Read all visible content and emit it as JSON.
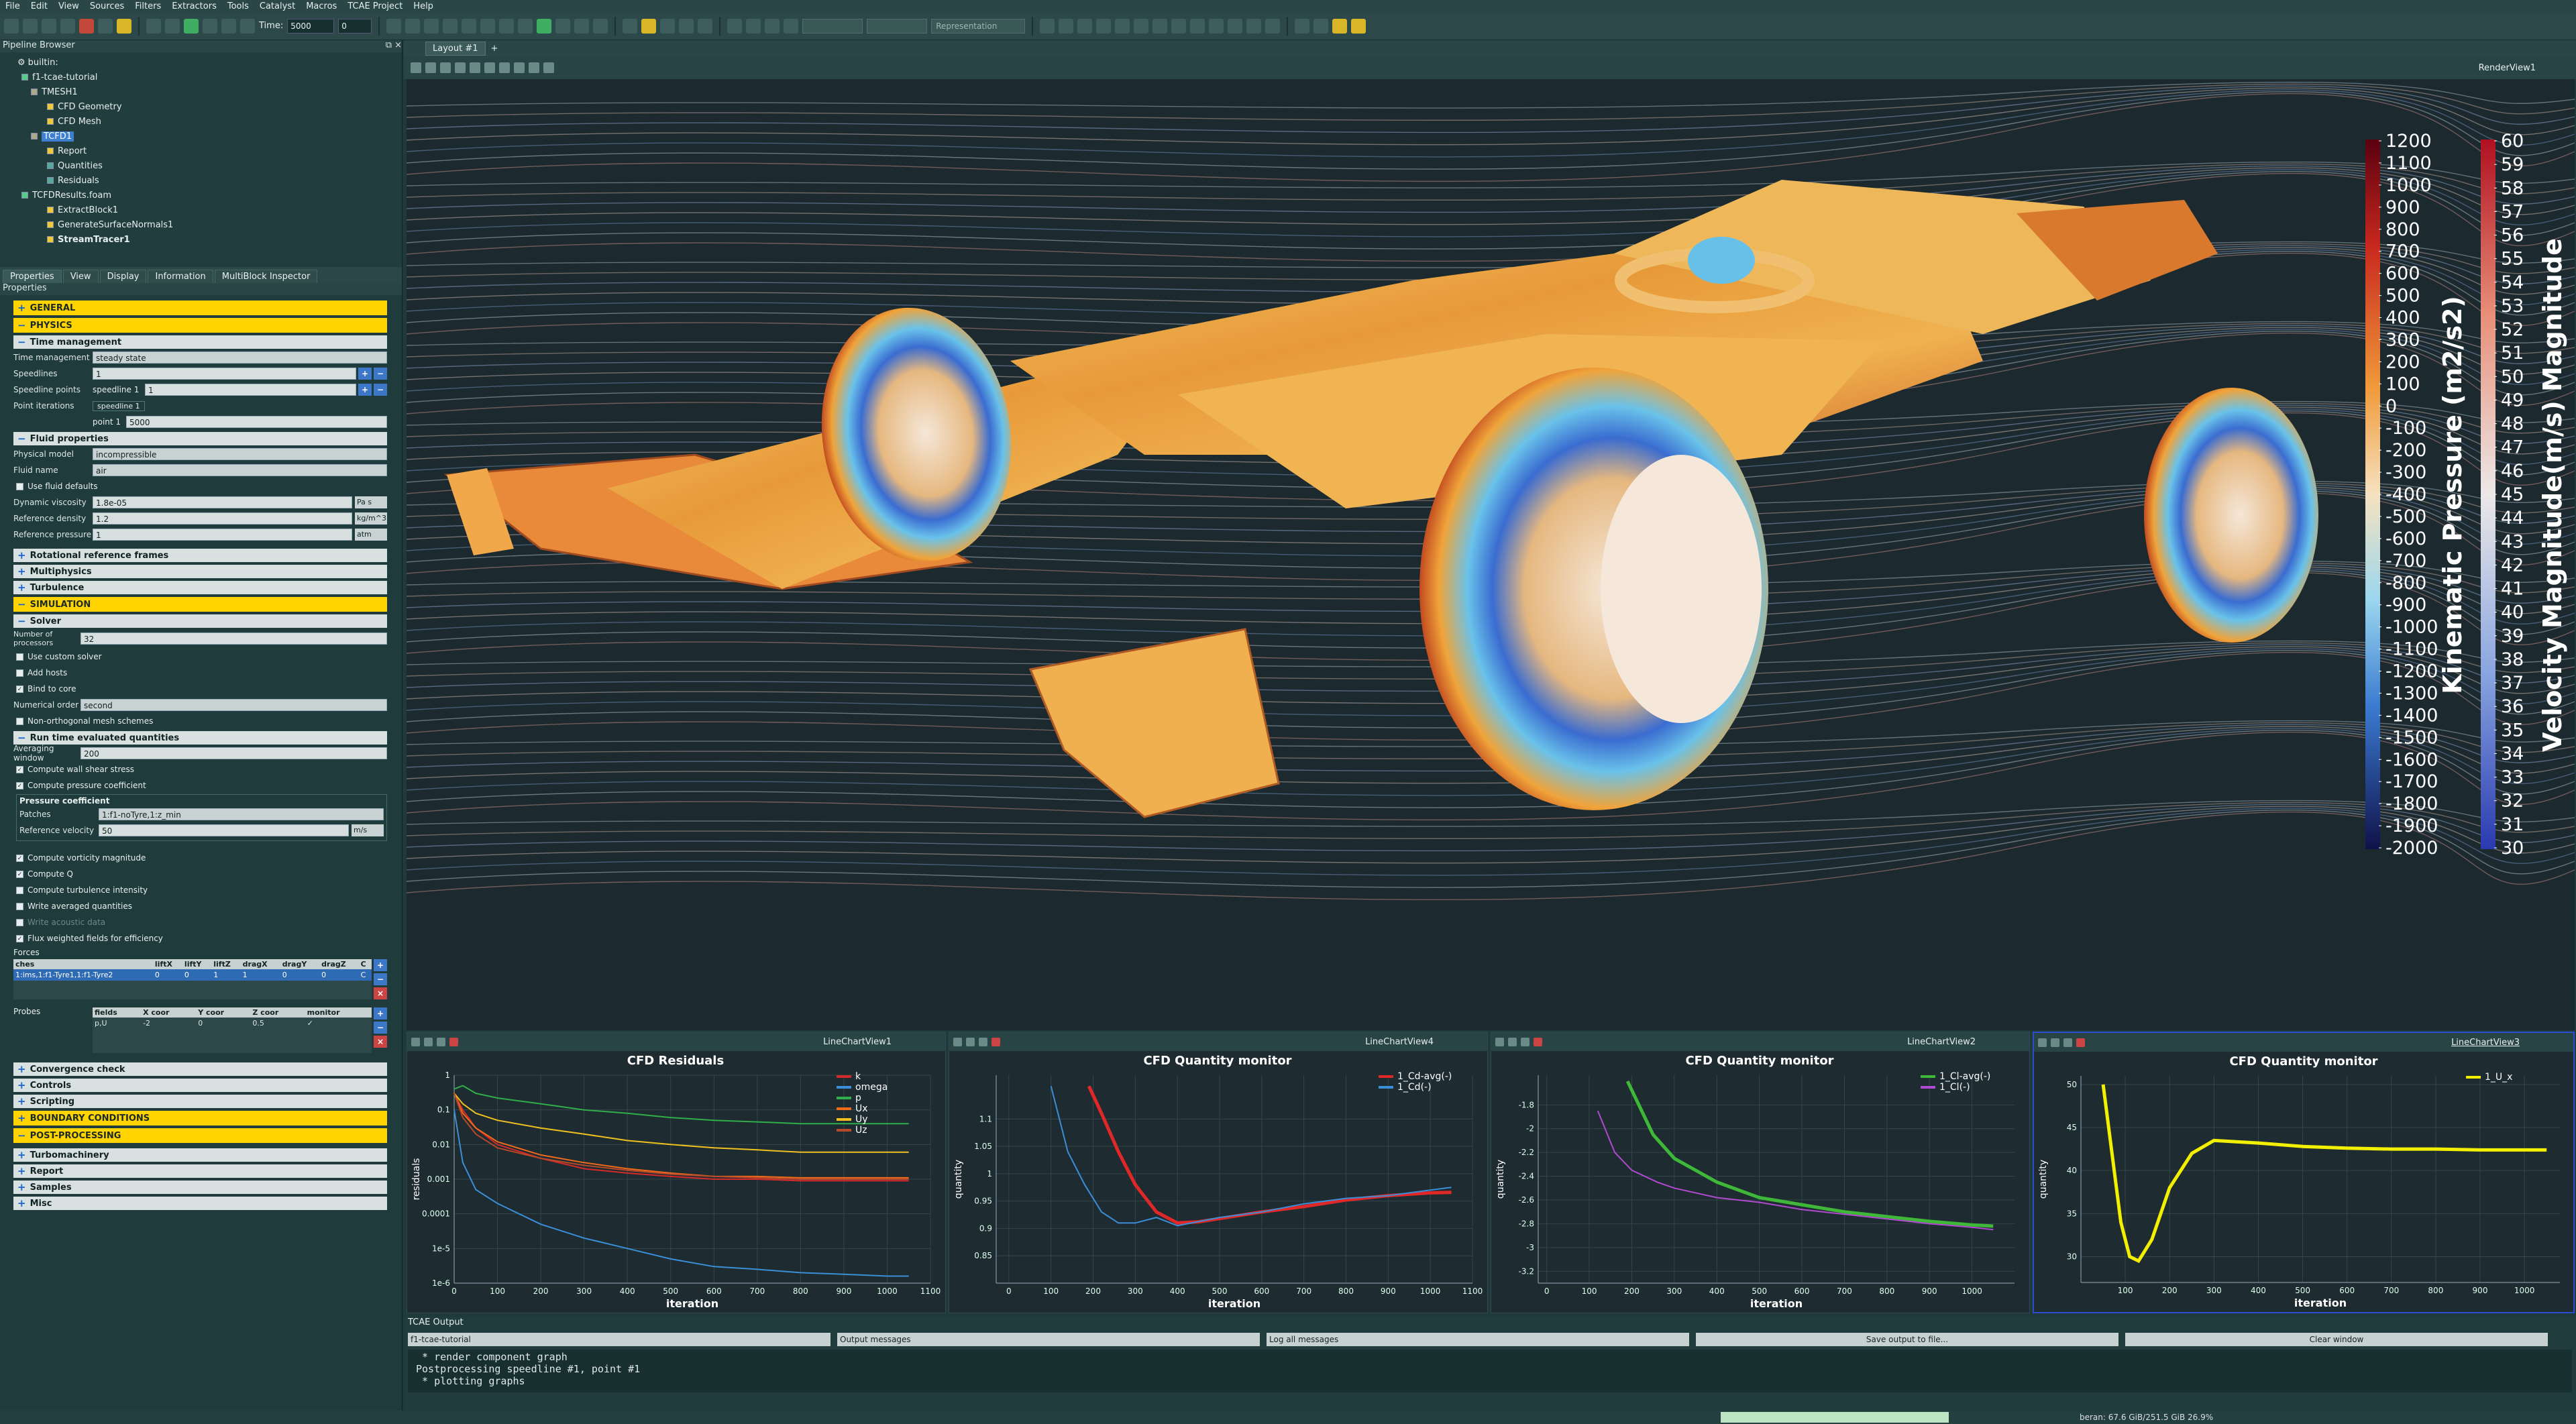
{
  "menu": [
    "File",
    "Edit",
    "View",
    "Sources",
    "Filters",
    "Extractors",
    "Tools",
    "Catalyst",
    "Macros",
    "TCAE Project",
    "Help"
  ],
  "toolbar": {
    "time_label": "Time:",
    "time_value": "5000",
    "time_index": "0",
    "representation": "Representation"
  },
  "pipeline": {
    "title": "Pipeline Browser",
    "items": [
      {
        "label": "builtin:"
      },
      {
        "label": "f1-tcae-tutorial"
      },
      {
        "label": "TMESH1"
      },
      {
        "label": "CFD Geometry"
      },
      {
        "label": "CFD Mesh"
      },
      {
        "label": "TCFD1"
      },
      {
        "label": "Report"
      },
      {
        "label": "Quantities"
      },
      {
        "label": "Residuals"
      },
      {
        "label": "TCFDResults.foam"
      },
      {
        "label": "ExtractBlock1"
      },
      {
        "label": "GenerateSurfaceNormals1"
      },
      {
        "label": "StreamTracer1"
      }
    ]
  },
  "tabs": [
    "Properties",
    "View",
    "Display",
    "Information",
    "MultiBlock Inspector"
  ],
  "props": {
    "title": "Properties",
    "general": "GENERAL",
    "physics": "PHYSICS",
    "time_mgmt": "Time management",
    "time_mgmt_label": "Time management",
    "time_mgmt_value": "steady state",
    "speedlines_label": "Speedlines",
    "speedlines_value": "1",
    "speedline_points_label": "Speedline points",
    "speedline_points_key": "speedline 1",
    "speedline_points_value": "1",
    "point_iterations_label": "Point iterations",
    "point_iter_tab": "speedline 1",
    "point_iter_key": "point 1",
    "point_iter_value": "5000",
    "fluid": "Fluid properties",
    "physical_model_label": "Physical model",
    "physical_model_value": "incompressible",
    "fluid_name_label": "Fluid name",
    "fluid_name_value": "air",
    "use_fluid_defaults": "Use fluid defaults",
    "dyn_visc_label": "Dynamic viscosity",
    "dyn_visc_value": "1.8e-05",
    "dyn_visc_unit": "Pa s",
    "ref_density_label": "Reference density",
    "ref_density_value": "1.2",
    "ref_density_unit": "kg/m^3",
    "ref_pressure_label": "Reference pressure",
    "ref_pressure_value": "1",
    "ref_pressure_unit": "atm",
    "rot_frames": "Rotational reference frames",
    "multiphysics": "Multiphysics",
    "turbulence": "Turbulence",
    "simulation": "SIMULATION",
    "solver": "Solver",
    "nproc_label": "Number of processors",
    "nproc_value": "32",
    "use_custom_solver": "Use custom solver",
    "add_hosts": "Add hosts",
    "bind_to_core": "Bind to core",
    "num_order_label": "Numerical order",
    "num_order_value": "second",
    "non_orth": "Non-orthogonal mesh schemes",
    "runtime": "Run time evaluated quantities",
    "avg_window_label": "Averaging window",
    "avg_window_value": "200",
    "wall_shear": "Compute wall shear stress",
    "press_coeff": "Compute pressure coefficient",
    "pc_group": "Pressure coefficient",
    "patches_label": "Patches",
    "patches_value": "1:f1-noTyre,1:z_min",
    "ref_vel_label": "Reference velocity",
    "ref_vel_value": "50",
    "ref_vel_unit": "m/s",
    "vort": "Compute vorticity magnitude",
    "compQ": "Compute Q",
    "turb_int": "Compute turbulence intensity",
    "write_avg": "Write averaged quantities",
    "write_acoustic": "Write acoustic data",
    "flux_weighted": "Flux weighted fields for efficiency",
    "forces_label": "Forces",
    "forces_headers": [
      "ches",
      "liftX",
      "liftY",
      "liftZ",
      "dragX",
      "dragY",
      "dragZ",
      "C"
    ],
    "forces_row": [
      "1:ims,1:f1-Tyre1,1:f1-Tyre2",
      "0",
      "0",
      "1",
      "1",
      "0",
      "0",
      "C"
    ],
    "probes_label": "Probes",
    "probes_headers": [
      "fields",
      "X coor",
      "Y coor",
      "Z coor",
      "monitor"
    ],
    "probes_row": [
      "p,U",
      "-2",
      "0",
      "0.5",
      "✓"
    ],
    "convergence": "Convergence check",
    "controls": "Controls",
    "scripting": "Scripting",
    "boundary": "BOUNDARY CONDITIONS",
    "post": "POST-PROCESSING",
    "turbomachinery": "Turbomachinery",
    "report": "Report",
    "samples": "Samples",
    "misc": "Misc"
  },
  "layout": {
    "tab": "Layout #1",
    "render_view": "RenderView1"
  },
  "colorbars": {
    "pressure": {
      "title": "Kinematic Pressure (m2/s2)",
      "ticks": [
        "1200",
        "1100",
        "1000",
        "900",
        "800",
        "700",
        "600",
        "500",
        "400",
        "300",
        "200",
        "100",
        "0",
        "-100",
        "-200",
        "-300",
        "-400",
        "-500",
        "-600",
        "-700",
        "-800",
        "-900",
        "-1000",
        "-1100",
        "-1200",
        "-1300",
        "-1400",
        "-1500",
        "-1600",
        "-1700",
        "-1800",
        "-1900",
        "-2000"
      ]
    },
    "velocity": {
      "title": "Velocity Magnitude(m/s) Magnitude",
      "ticks": [
        "60",
        "59",
        "58",
        "57",
        "56",
        "55",
        "54",
        "53",
        "52",
        "51",
        "50",
        "49",
        "48",
        "47",
        "46",
        "45",
        "44",
        "43",
        "42",
        "41",
        "40",
        "39",
        "38",
        "37",
        "36",
        "35",
        "34",
        "33",
        "32",
        "31",
        "30"
      ]
    }
  },
  "charts": [
    {
      "view": "LineChartView1",
      "title": "CFD Residuals",
      "xlabel": "iteration",
      "ylabel": "residuals"
    },
    {
      "view": "LineChartView4",
      "title": "CFD Quantity monitor",
      "xlabel": "iteration",
      "ylabel": "quantity"
    },
    {
      "view": "LineChartView2",
      "title": "CFD Quantity monitor",
      "xlabel": "iteration",
      "ylabel": "quantity"
    },
    {
      "view": "LineChartView3",
      "title": "CFD Quantity monitor",
      "xlabel": "iteration",
      "ylabel": "quantity"
    }
  ],
  "chart_data": [
    {
      "type": "line",
      "title": "CFD Residuals",
      "xlabel": "iteration",
      "ylabel": "residuals",
      "xlim": [
        0,
        1100
      ],
      "ylog": true,
      "x_ticks": [
        "0",
        "100",
        "200",
        "300",
        "400",
        "500",
        "600",
        "700",
        "800",
        "900",
        "1000",
        "1100"
      ],
      "y_ticks": [
        "1",
        "0.1",
        "0.01",
        "0.001",
        "0.0001",
        "1e-5",
        "1e-6"
      ],
      "series": [
        {
          "name": "k",
          "color": "#d42a2a",
          "x": [
            0,
            20,
            50,
            100,
            200,
            300,
            400,
            500,
            600,
            700,
            800,
            900,
            1000,
            1050
          ],
          "y": [
            0.3,
            0.1,
            0.03,
            0.01,
            0.004,
            0.002,
            0.0015,
            0.0012,
            0.001,
            0.001,
            0.0009,
            0.0009,
            0.0009,
            0.0009
          ]
        },
        {
          "name": "omega",
          "color": "#3a8fd8",
          "x": [
            0,
            20,
            50,
            100,
            200,
            300,
            400,
            500,
            600,
            700,
            800,
            900,
            1000,
            1050
          ],
          "y": [
            0.1,
            0.003,
            0.0005,
            0.0002,
            5e-05,
            2e-05,
            1e-05,
            5e-06,
            3e-06,
            2.5e-06,
            2e-06,
            1.8e-06,
            1.6e-06,
            1.6e-06
          ]
        },
        {
          "name": "p",
          "color": "#2fae4a",
          "x": [
            0,
            20,
            50,
            100,
            200,
            300,
            400,
            500,
            600,
            700,
            800,
            900,
            1000,
            1050
          ],
          "y": [
            0.4,
            0.5,
            0.3,
            0.22,
            0.15,
            0.1,
            0.08,
            0.06,
            0.05,
            0.045,
            0.04,
            0.04,
            0.04,
            0.04
          ]
        },
        {
          "name": "Ux",
          "color": "#f06a1a",
          "x": [
            0,
            20,
            50,
            100,
            200,
            300,
            400,
            500,
            600,
            700,
            800,
            900,
            1000,
            1050
          ],
          "y": [
            0.3,
            0.08,
            0.03,
            0.012,
            0.005,
            0.003,
            0.002,
            0.0015,
            0.0012,
            0.0012,
            0.0011,
            0.0011,
            0.0011,
            0.0011
          ]
        },
        {
          "name": "Uy",
          "color": "#f0c020",
          "x": [
            0,
            20,
            50,
            100,
            200,
            300,
            400,
            500,
            600,
            700,
            800,
            900,
            1000,
            1050
          ],
          "y": [
            0.3,
            0.15,
            0.08,
            0.05,
            0.03,
            0.02,
            0.013,
            0.01,
            0.008,
            0.007,
            0.006,
            0.006,
            0.006,
            0.006
          ]
        },
        {
          "name": "Uz",
          "color": "#b74a2a",
          "x": [
            0,
            20,
            50,
            100,
            200,
            300,
            400,
            500,
            600,
            700,
            800,
            900,
            1000,
            1050
          ],
          "y": [
            0.3,
            0.06,
            0.02,
            0.008,
            0.004,
            0.0025,
            0.0018,
            0.0014,
            0.0012,
            0.0011,
            0.001,
            0.001,
            0.001,
            0.001
          ]
        }
      ]
    },
    {
      "type": "line",
      "title": "CFD Quantity monitor",
      "xlabel": "iteration",
      "ylabel": "quantity",
      "xlim": [
        -30,
        1100
      ],
      "ylim": [
        0.8,
        1.18
      ],
      "x_ticks": [
        "0",
        "100",
        "200",
        "300",
        "400",
        "500",
        "600",
        "700",
        "800",
        "900",
        "1000",
        "1100"
      ],
      "y_ticks": [
        "1.1",
        "1.05",
        "1",
        "0.95",
        "0.9",
        "0.85"
      ],
      "series": [
        {
          "name": "1_Cd-avg(-)",
          "color": "#e02828",
          "x": [
            190,
            220,
            260,
            300,
            350,
            400,
            450,
            500,
            600,
            700,
            800,
            900,
            1000,
            1050
          ],
          "y": [
            1.16,
            1.11,
            1.04,
            0.98,
            0.93,
            0.91,
            0.912,
            0.918,
            0.93,
            0.94,
            0.952,
            0.96,
            0.965,
            0.966
          ]
        },
        {
          "name": "1_Cd(-)",
          "color": "#3a8fd8",
          "x": [
            100,
            140,
            180,
            220,
            260,
            300,
            350,
            400,
            500,
            600,
            700,
            800,
            900,
            1000,
            1050
          ],
          "y": [
            1.16,
            1.04,
            0.98,
            0.93,
            0.91,
            0.91,
            0.92,
            0.905,
            0.92,
            0.93,
            0.945,
            0.955,
            0.96,
            0.97,
            0.975
          ]
        }
      ]
    },
    {
      "type": "line",
      "title": "CFD Quantity monitor",
      "xlabel": "iteration",
      "ylabel": "quantity",
      "xlim": [
        -20,
        1100
      ],
      "ylim": [
        -3.3,
        -1.55
      ],
      "x_ticks": [
        "0",
        "100",
        "200",
        "300",
        "400",
        "500",
        "600",
        "700",
        "800",
        "900",
        "1000"
      ],
      "y_ticks": [
        "-1.8",
        "-2",
        "-2.2",
        "-2.4",
        "-2.6",
        "-2.8",
        "-3",
        "-3.2"
      ],
      "series": [
        {
          "name": "1_Cl-avg(-)",
          "color": "#3fb83a",
          "x": [
            190,
            250,
            300,
            400,
            500,
            600,
            700,
            800,
            900,
            1000,
            1050
          ],
          "y": [
            -1.6,
            -2.05,
            -2.25,
            -2.45,
            -2.58,
            -2.64,
            -2.7,
            -2.74,
            -2.78,
            -2.81,
            -2.82
          ]
        },
        {
          "name": "1_Cl(-)",
          "color": "#b04ad0",
          "x": [
            120,
            160,
            200,
            260,
            300,
            400,
            500,
            600,
            700,
            800,
            900,
            1000,
            1050
          ],
          "y": [
            -1.85,
            -2.2,
            -2.35,
            -2.45,
            -2.5,
            -2.58,
            -2.62,
            -2.68,
            -2.72,
            -2.76,
            -2.8,
            -2.83,
            -2.85
          ]
        }
      ]
    },
    {
      "type": "line",
      "title": "CFD Quantity monitor",
      "xlabel": "iteration",
      "ylabel": "quantity",
      "xlim": [
        0,
        1080
      ],
      "ylim": [
        27,
        51
      ],
      "x_ticks": [
        "100",
        "200",
        "300",
        "400",
        "500",
        "600",
        "700",
        "800",
        "900",
        "1000"
      ],
      "y_ticks": [
        "50",
        "45",
        "40",
        "35",
        "30"
      ],
      "series": [
        {
          "name": "1_U_x",
          "color": "#f2f000",
          "x": [
            50,
            70,
            90,
            110,
            130,
            160,
            200,
            250,
            300,
            400,
            500,
            600,
            700,
            800,
            900,
            1000,
            1050
          ],
          "y": [
            50,
            42,
            34,
            30,
            29.5,
            32,
            38,
            42,
            43.5,
            43.2,
            42.8,
            42.6,
            42.5,
            42.5,
            42.4,
            42.4,
            42.4
          ]
        }
      ]
    }
  ],
  "output": {
    "title": "TCAE Output",
    "project": "f1-tcae-tutorial",
    "messages": "Output messages",
    "log": "Log all messages",
    "save": "Save output to file...",
    "clear": "Clear window",
    "lines": " * render component graph\nPostprocessing speedline #1, point #1\n * plotting graphs"
  },
  "status": {
    "memory": "beran: 67.6 GiB/251.5 GiB 26.9%"
  }
}
